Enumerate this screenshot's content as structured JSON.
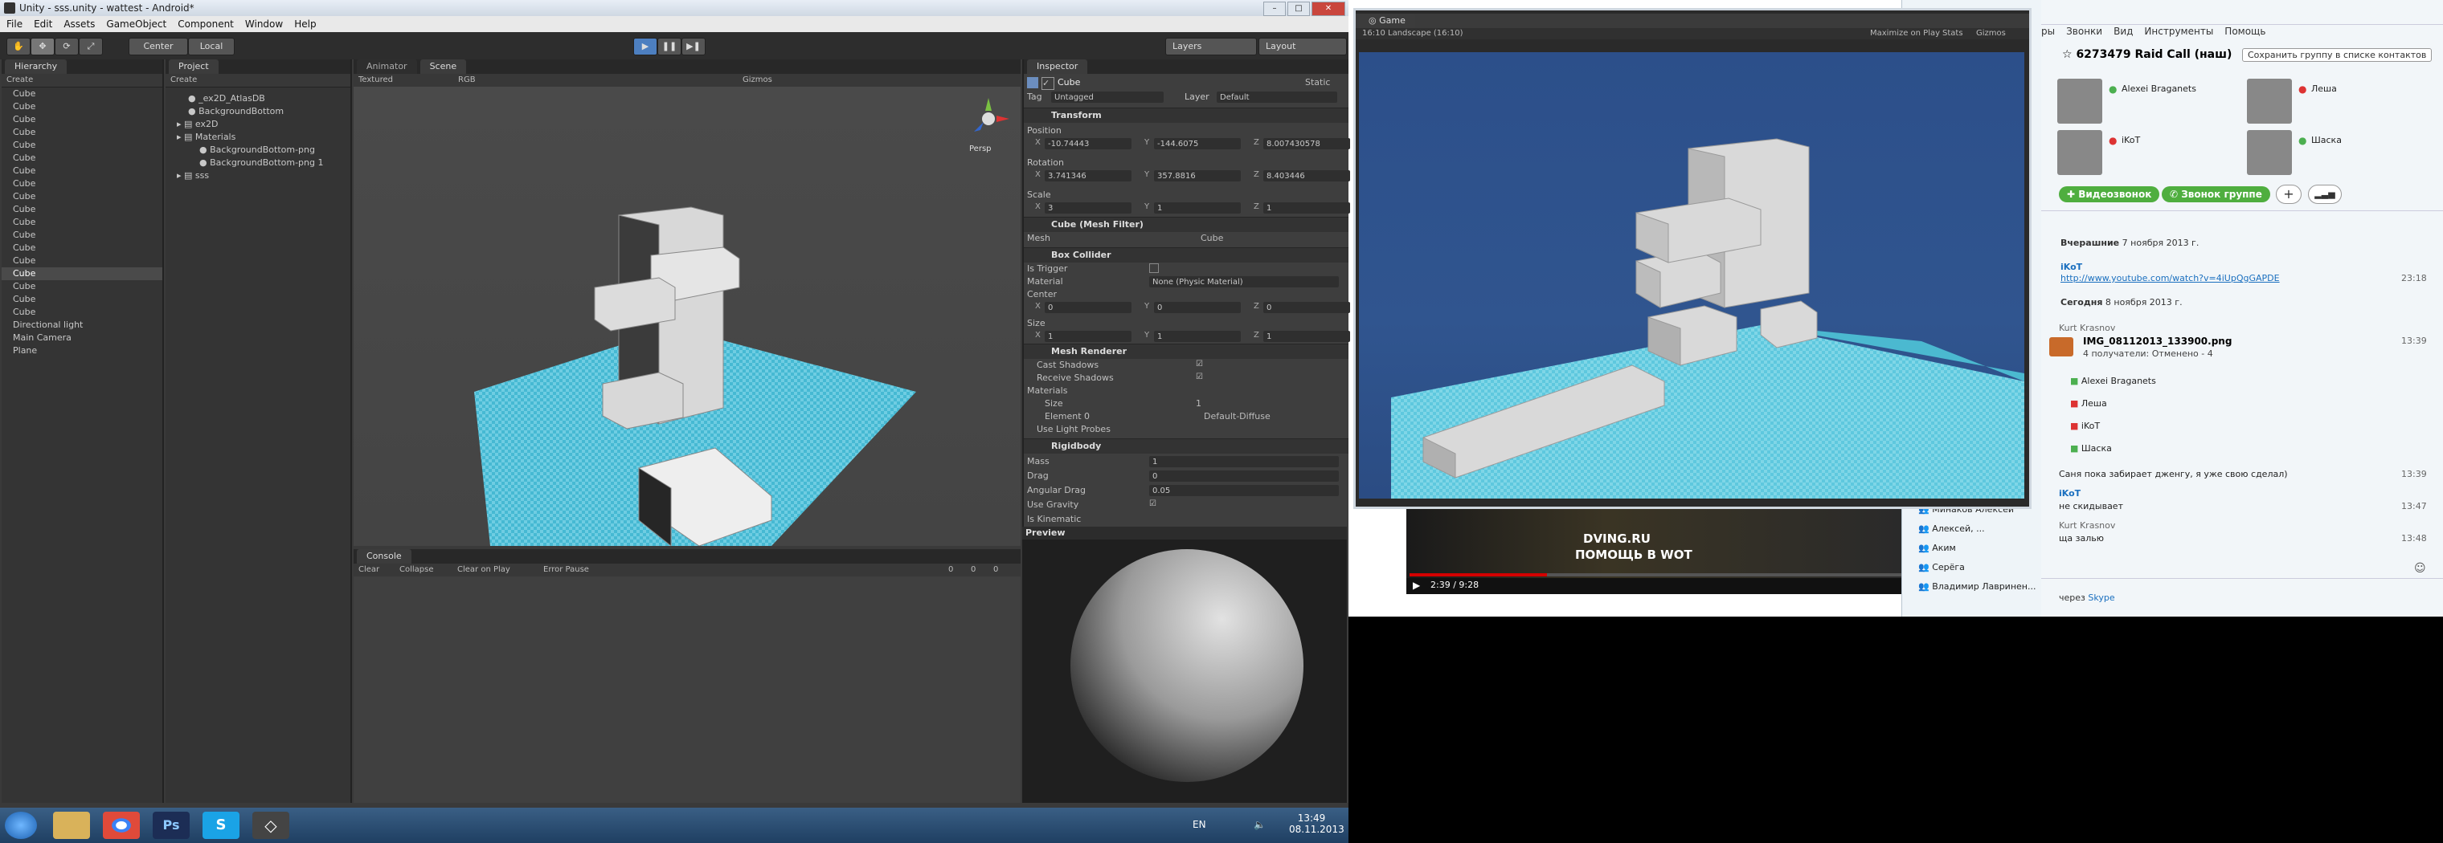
{
  "unity": {
    "title": "Unity - sss.unity - wattest - Android*",
    "menu": [
      "File",
      "Edit",
      "Assets",
      "GameObject",
      "Component",
      "Window",
      "Help"
    ],
    "toolbar": {
      "pivot": "Center",
      "space": "Local",
      "layers": "Layers",
      "layout": "Layout"
    },
    "hierarchy": {
      "tab": "Hierarchy",
      "create": "Create",
      "items": [
        "Cube",
        "Cube",
        "Cube",
        "Cube",
        "Cube",
        "Cube",
        "Cube",
        "Cube",
        "Cube",
        "Cube",
        "Cube",
        "Cube",
        "Cube",
        "Cube",
        "Cube",
        "Cube",
        "Cube",
        "Cube",
        "Directional light",
        "Main Camera",
        "Plane"
      ],
      "selected_index": 14
    },
    "project": {
      "tab": "Project",
      "create": "Create",
      "items": [
        {
          "label": "_ex2D_AtlasDB",
          "indent": 1
        },
        {
          "label": "BackgroundBottom",
          "indent": 1
        },
        {
          "label": "ex2D",
          "indent": 0
        },
        {
          "label": "Materials",
          "indent": 0
        },
        {
          "label": "BackgroundBottom-png",
          "indent": 2
        },
        {
          "label": "BackgroundBottom-png 1",
          "indent": 2
        },
        {
          "label": "sss",
          "indent": 0
        }
      ]
    },
    "scene": {
      "tabs": [
        "Animator",
        "Scene"
      ],
      "shading": "Textured",
      "render": "RGB",
      "gizmos": "Gizmos",
      "persp": "Persp"
    },
    "console": {
      "tab": "Console",
      "buttons": [
        "Clear",
        "Collapse",
        "Clear on Play",
        "Error Pause"
      ],
      "counts": [
        "0",
        "0",
        "0"
      ]
    },
    "inspector": {
      "tab": "Inspector",
      "object_name": "Cube",
      "static": "Static",
      "tag_label": "Tag",
      "tag": "Untagged",
      "layer_label": "Layer",
      "layer": "Default",
      "transform": {
        "title": "Transform",
        "position_label": "Position",
        "position": {
          "x": "-10.74443",
          "y": "-144.6075",
          "z": "8.007430578"
        },
        "rotation_label": "Rotation",
        "rotation": {
          "x": "3.741346",
          "y": "357.8816",
          "z": "8.403446"
        },
        "scale_label": "Scale",
        "scale": {
          "x": "3",
          "y": "1",
          "z": "1"
        }
      },
      "mesh_filter": {
        "title": "Cube (Mesh Filter)",
        "mesh_label": "Mesh",
        "mesh": "Cube"
      },
      "box_collider": {
        "title": "Box Collider",
        "is_trigger": "Is Trigger",
        "material_label": "Material",
        "material": "None (Physic Material)",
        "center_label": "Center",
        "center": {
          "x": "0",
          "y": "0",
          "z": "0"
        },
        "size_label": "Size",
        "size": {
          "x": "1",
          "y": "1",
          "z": "1"
        }
      },
      "mesh_renderer": {
        "title": "Mesh Renderer",
        "cast_shadows": "Cast Shadows",
        "receive_shadows": "Receive Shadows",
        "materials": "Materials",
        "size_label": "Size",
        "size": "1",
        "element_label": "Element 0",
        "element": "Default-Diffuse",
        "light_probes": "Use Light Probes"
      },
      "rigidbody": {
        "title": "Rigidbody",
        "mass_label": "Mass",
        "mass": "1",
        "drag_label": "Drag",
        "drag": "0",
        "angular_label": "Angular Drag",
        "angular": "0.05",
        "gravity_label": "Use Gravity",
        "kinematic_label": "Is Kinematic"
      },
      "preview": "Preview"
    }
  },
  "game": {
    "tab": "Game",
    "aspect": "16:10 Landscape (16:10)",
    "maximize": "Maximize on Play",
    "stats": "Stats",
    "gizmos": "Gizmos"
  },
  "video": {
    "site": "DVING.RU",
    "slogan": "ПОМОЩЬ В WOT",
    "time": "2:39",
    "duration": "9:28",
    "progress": 0.28
  },
  "skype": {
    "menu": [
      "ры",
      "Звонки",
      "Вид",
      "Инструменты",
      "Помощь"
    ],
    "group": "6273479 Raid Call (наш)",
    "save_btn": "Сохранить группу в списке контактов",
    "members": [
      {
        "name": "Alexei Braganets"
      },
      {
        "name": "Леша"
      },
      {
        "name": "iKoT"
      },
      {
        "name": "Шаска"
      }
    ],
    "video_btn": "Видеозвонок",
    "call_btn": "Звонок группе",
    "day1_label": "Вчерашние",
    "day1": "7 ноября 2013 г.",
    "sender1": "iKoT",
    "link": "http://www.youtube.com/watch?v=4iUpQgGAPDE",
    "link_time": "23:18",
    "day2_label": "Сегодня",
    "day2": "8 ноября 2013 г.",
    "sender2": "Kurt Krasnov",
    "file": "IMG_08112013_133900.png",
    "file_time": "13:39",
    "recipients": "4 получатели: Отменено - 4",
    "recipient_list": [
      "Alexei Braganets",
      "Леша",
      "iKoT",
      "Шаска"
    ],
    "msg1": "Саня пока забирает дженгу, я уже свою сделал)",
    "msg1_time": "13:39",
    "sender3": "iKoT",
    "msg2": "не скидывает",
    "msg2_time": "13:47",
    "sender4": "Kurt Krasnov",
    "msg3": "ща залью",
    "msg3_time": "13:48",
    "via": "через",
    "via_link": "Skype",
    "contacts": [
      "Минаков Алексей",
      "Алексей, ...",
      "Аким",
      "Серёга",
      "Владимир Лавринен..."
    ]
  },
  "taskbar": {
    "lang": "EN",
    "time": "13:49",
    "date": "08.11.2013"
  },
  "colors": {
    "unity_bg": "#3a3a3a",
    "game_sky": "#2f5590",
    "plane": "#4fc3d9",
    "skype_green": "#4caf50"
  }
}
